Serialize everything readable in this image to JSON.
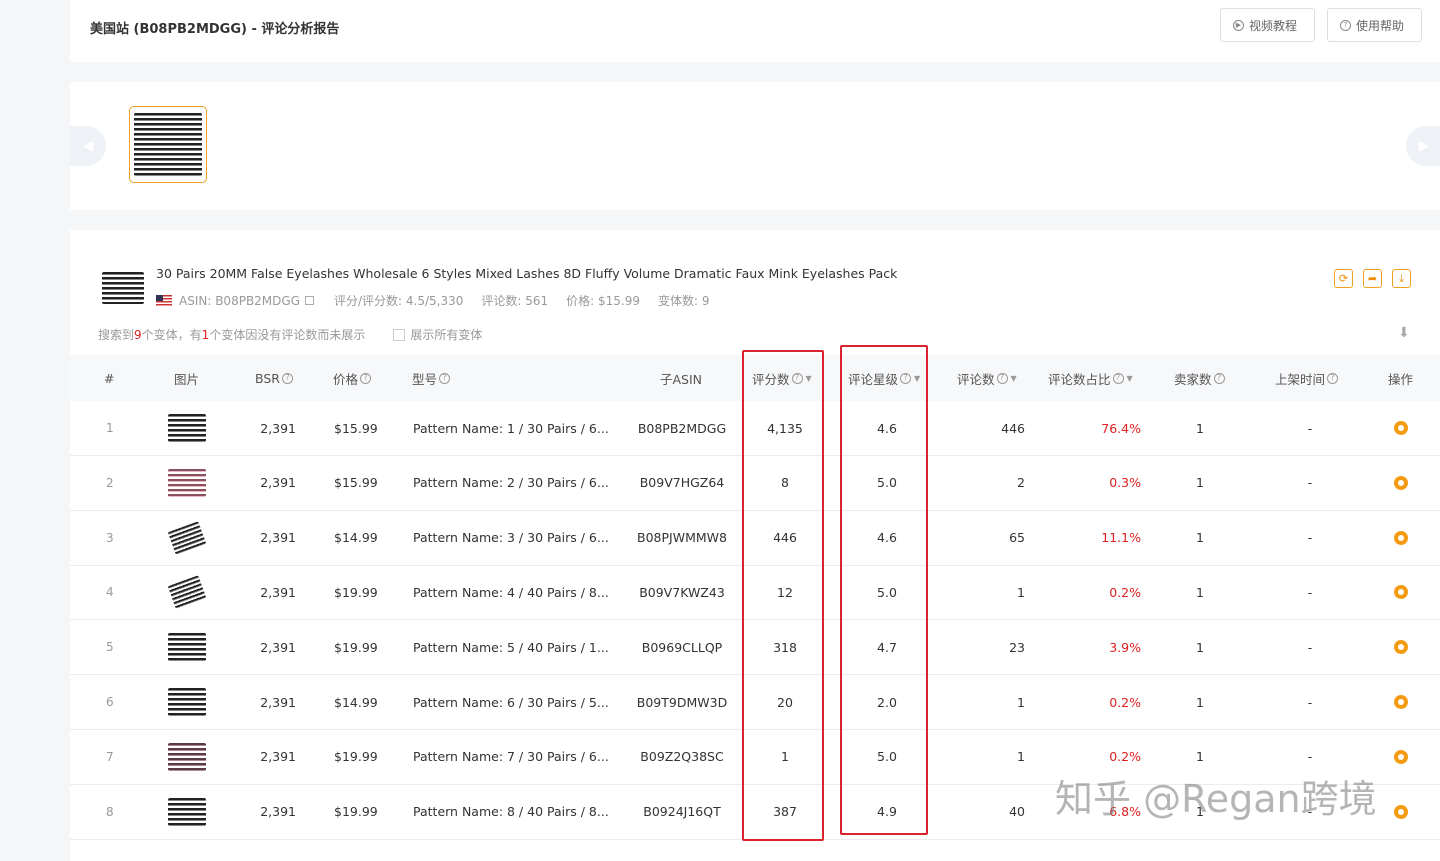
{
  "header": {
    "title": "美国站 (B08PB2MDGG) - 评论分析报告",
    "video_tutorial": "视频教程",
    "help": "使用帮助"
  },
  "product": {
    "title": "30 Pairs 20MM False Eyelashes Wholesale 6 Styles Mixed Lashes 8D Fluffy Volume Dramatic Faux Mink Eyelashes Pack",
    "asin_label": "ASIN: B08PB2MDGG",
    "rating": "评分/评分数: 4.5/5,330",
    "reviews": "评论数: 561",
    "price": "价格: $15.99",
    "variants": "变体数: 9"
  },
  "summary": {
    "prefix": "搜索到",
    "found": "9",
    "middle": "个变体，有",
    "hidden": "1",
    "suffix": "个变体因没有评论数而未展示",
    "show_all": "展示所有变体"
  },
  "table": {
    "columns": [
      "#",
      "图片",
      "BSR",
      "价格",
      "型号",
      "子ASIN",
      "评分数",
      "评论星级",
      "评论数",
      "评论数占比",
      "卖家数",
      "上架时间",
      "操作"
    ],
    "rows": [
      {
        "idx": "1",
        "bsr": "2,391",
        "price": "$15.99",
        "model": "Pattern Name: 1 / 30 Pairs / 6...",
        "asin": "B08PB2MDGG",
        "ratings": "4,135",
        "stars": "4.6",
        "reviews": "446",
        "pct": "76.4%",
        "sellers": "1",
        "date": "-"
      },
      {
        "idx": "2",
        "bsr": "2,391",
        "price": "$15.99",
        "model": "Pattern Name: 2 / 30 Pairs / 6...",
        "asin": "B09V7HGZ64",
        "ratings": "8",
        "stars": "5.0",
        "reviews": "2",
        "pct": "0.3%",
        "sellers": "1",
        "date": "-"
      },
      {
        "idx": "3",
        "bsr": "2,391",
        "price": "$14.99",
        "model": "Pattern Name: 3 / 30 Pairs / 6...",
        "asin": "B08PJWMMW8",
        "ratings": "446",
        "stars": "4.6",
        "reviews": "65",
        "pct": "11.1%",
        "sellers": "1",
        "date": "-"
      },
      {
        "idx": "4",
        "bsr": "2,391",
        "price": "$19.99",
        "model": "Pattern Name: 4 / 40 Pairs / 8...",
        "asin": "B09V7KWZ43",
        "ratings": "12",
        "stars": "5.0",
        "reviews": "1",
        "pct": "0.2%",
        "sellers": "1",
        "date": "-"
      },
      {
        "idx": "5",
        "bsr": "2,391",
        "price": "$19.99",
        "model": "Pattern Name: 5 / 40 Pairs / 1...",
        "asin": "B0969CLLQP",
        "ratings": "318",
        "stars": "4.7",
        "reviews": "23",
        "pct": "3.9%",
        "sellers": "1",
        "date": "-"
      },
      {
        "idx": "6",
        "bsr": "2,391",
        "price": "$14.99",
        "model": "Pattern Name: 6 / 30 Pairs / 5...",
        "asin": "B09T9DMW3D",
        "ratings": "20",
        "stars": "2.0",
        "reviews": "1",
        "pct": "0.2%",
        "sellers": "1",
        "date": "-"
      },
      {
        "idx": "7",
        "bsr": "2,391",
        "price": "$19.99",
        "model": "Pattern Name: 7 / 30 Pairs / 6...",
        "asin": "B09Z2Q38SC",
        "ratings": "1",
        "stars": "5.0",
        "reviews": "1",
        "pct": "0.2%",
        "sellers": "1",
        "date": "-"
      },
      {
        "idx": "8",
        "bsr": "2,391",
        "price": "$19.99",
        "model": "Pattern Name: 8 / 40 Pairs / 8...",
        "asin": "B0924J16QT",
        "ratings": "387",
        "stars": "4.9",
        "reviews": "40",
        "pct": "6.8%",
        "sellers": "1",
        "date": "-"
      }
    ]
  },
  "watermark": "知乎 @Regan跨境",
  "colors": {
    "accent": "#f39c12",
    "highlight": "#d9232d",
    "negative": "#e02020"
  }
}
